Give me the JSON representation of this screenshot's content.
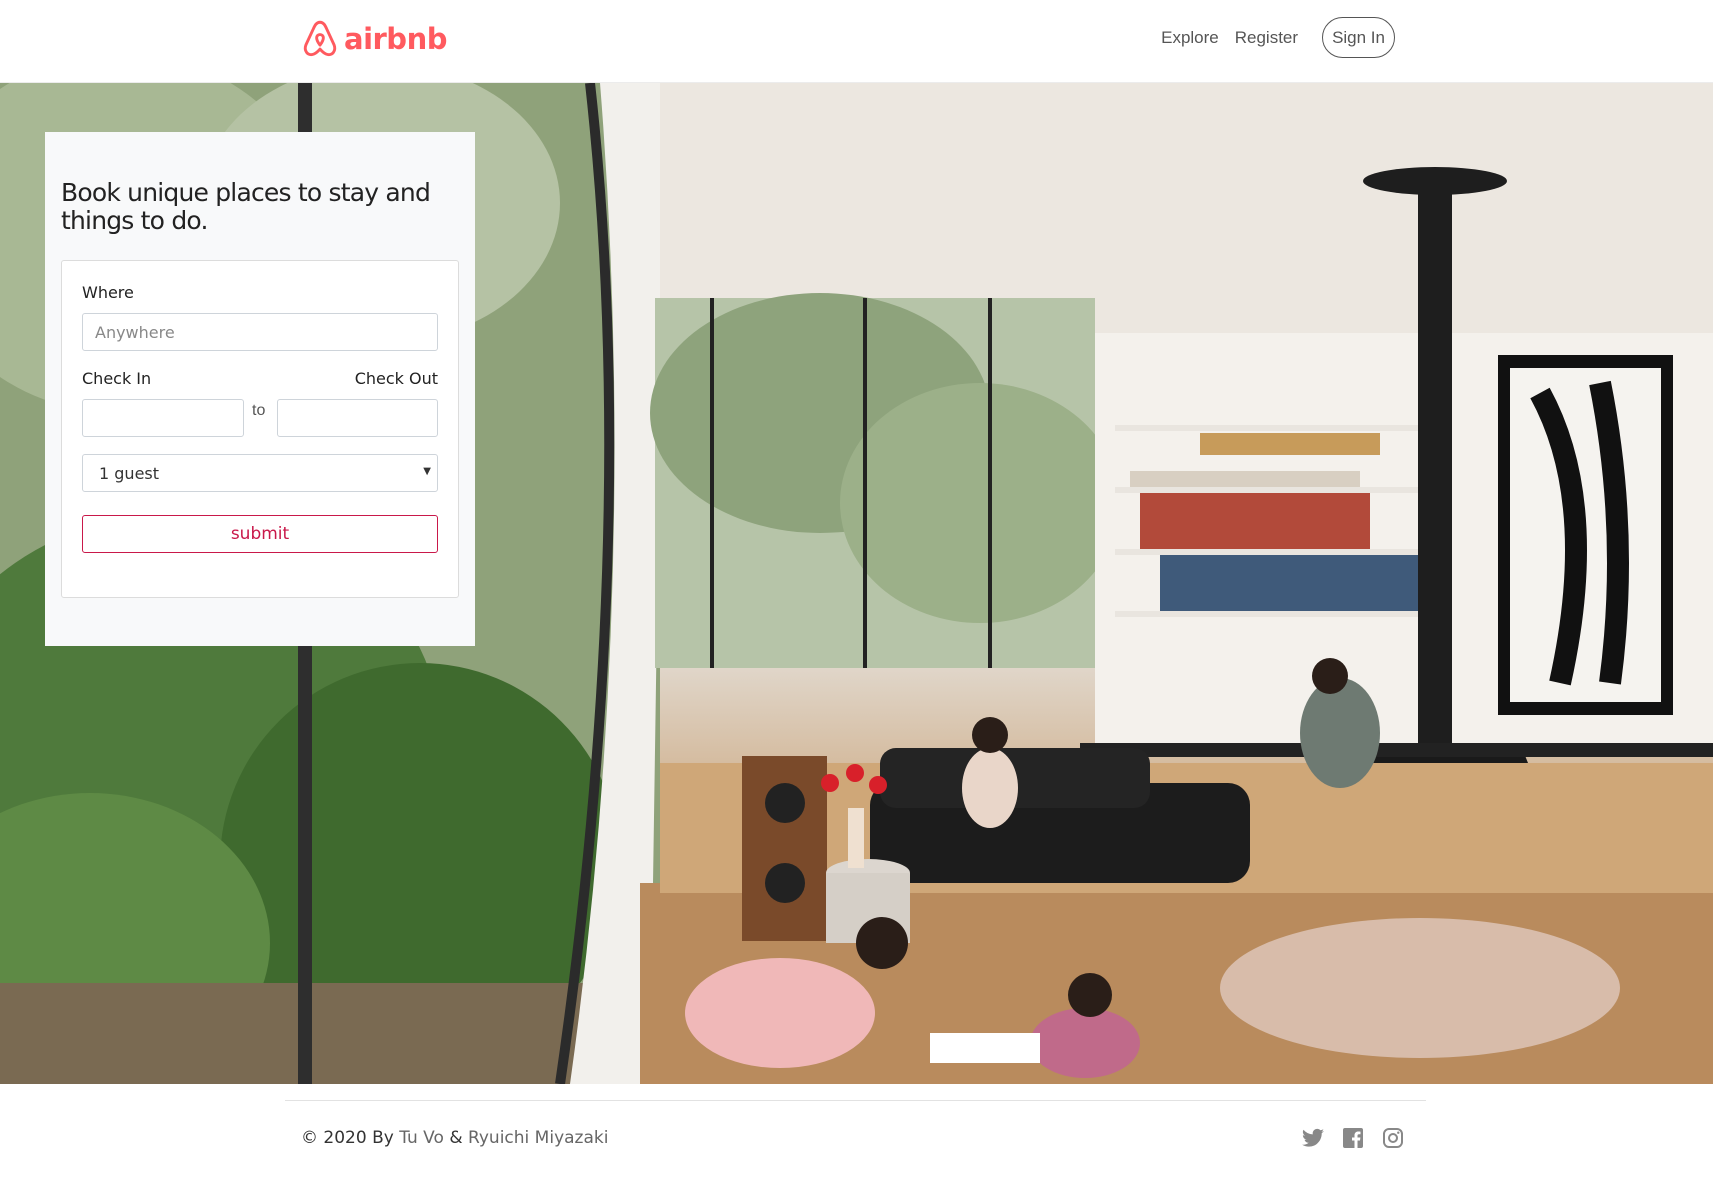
{
  "header": {
    "logo_text": "airbnb",
    "nav": {
      "explore": "Explore",
      "register": "Register",
      "sign_in": "Sign In"
    }
  },
  "booking": {
    "title": "Book unique places to stay and things to do.",
    "where_label": "Where",
    "where_placeholder": "Anywhere",
    "check_in_label": "Check In",
    "check_out_label": "Check Out",
    "to_text": "to",
    "guests_selected": "1 guest",
    "submit_label": "submit"
  },
  "footer": {
    "copyright": "© 2020 By",
    "author1": "Tu Vo",
    "ampersand": "&",
    "author2": "Ryuichi Miyazaki",
    "social_icons": [
      "twitter-icon",
      "facebook-icon",
      "instagram-icon"
    ]
  },
  "colors": {
    "brand": "#ff5a5f",
    "submit_accent": "#c9184a"
  }
}
